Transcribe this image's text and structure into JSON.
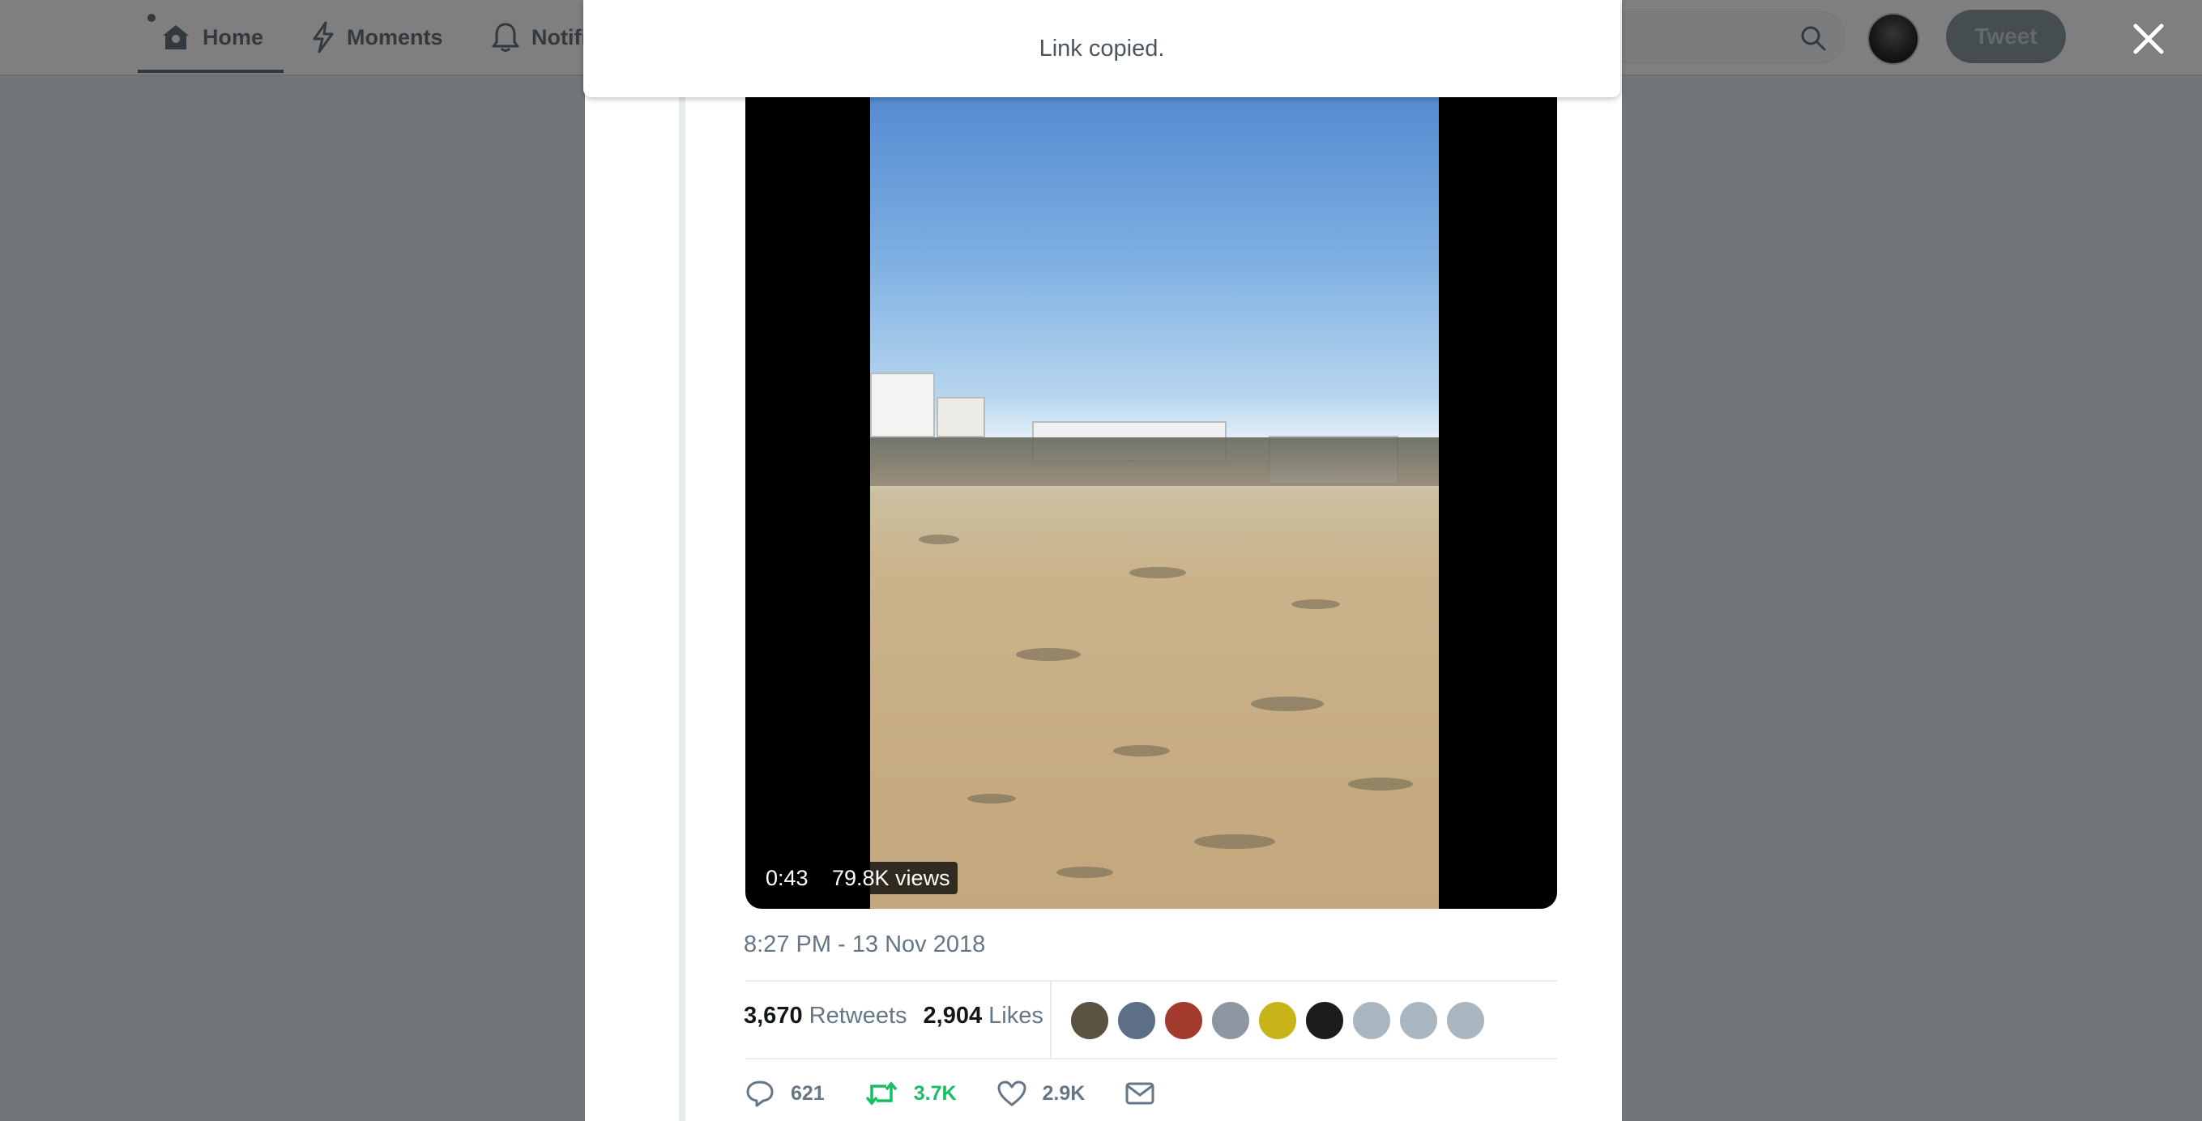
{
  "nav": {
    "home_label": "Home",
    "moments_label": "Moments",
    "notifications_label": "Notifi",
    "search_hint": "r",
    "tweet_button": "Tweet"
  },
  "toast": {
    "message": "Link copied."
  },
  "video": {
    "duration": "0:43",
    "views": "79.8K views"
  },
  "tweet": {
    "timestamp": "8:27 PM - 13 Nov 2018",
    "retweets_count": "3,670",
    "retweets_label": "Retweets",
    "likes_count": "2,904",
    "likes_label": "Likes",
    "liker_colors": [
      "#5a5140",
      "#5c6f86",
      "#a23b2e",
      "#8d97a1",
      "#c8b418",
      "#1c1c1c",
      "#a9b6c0",
      "#a9b6c0",
      "#a9b6c0"
    ]
  },
  "actions": {
    "reply_count": "621",
    "retweet_count": "3.7K",
    "like_count": "2.9K"
  },
  "colors": {
    "retweet_green": "#17bf63",
    "text_gray": "#657786",
    "tweet_button_bg": "#8d9aa3"
  }
}
